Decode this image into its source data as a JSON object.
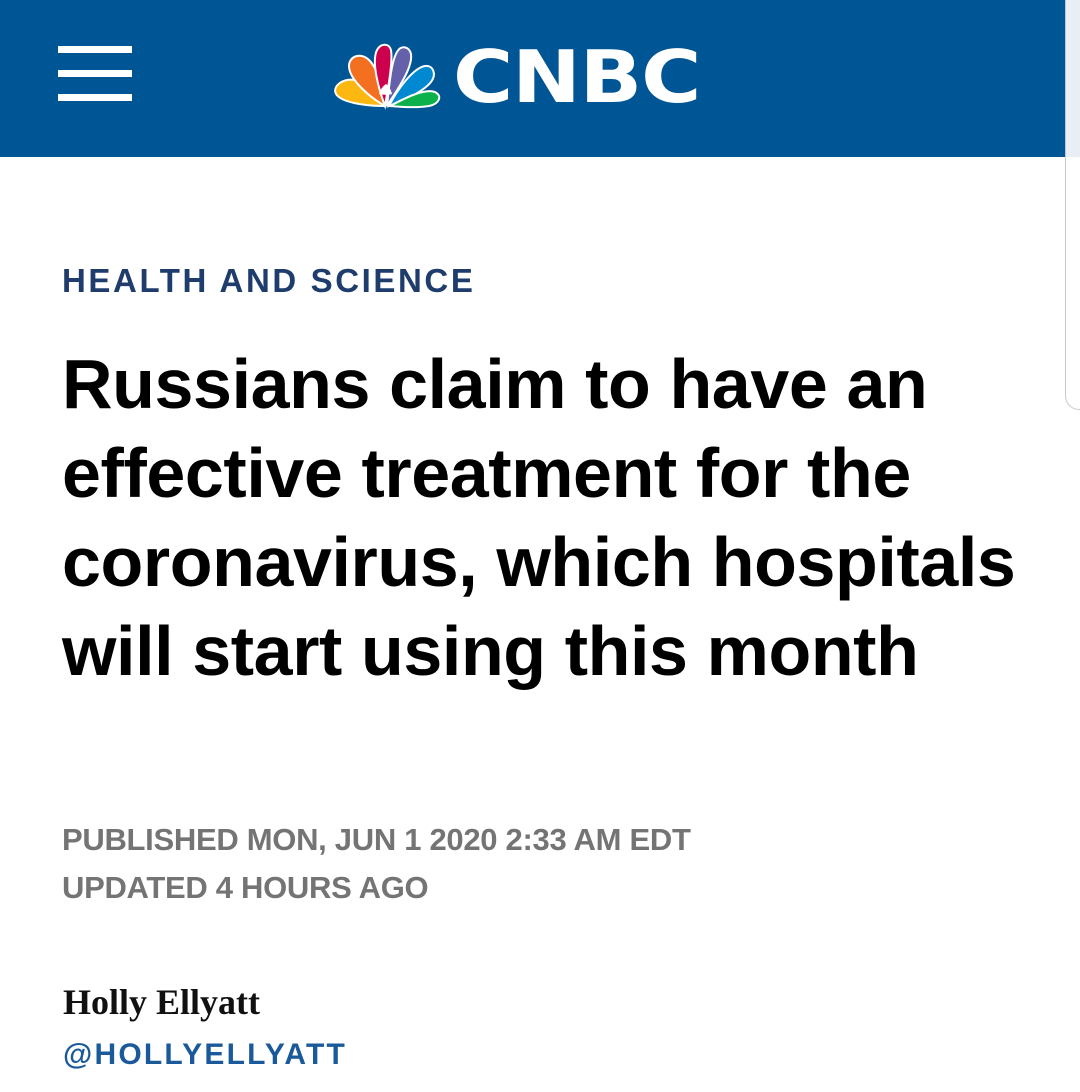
{
  "header": {
    "menu_icon": "hamburger-menu-icon",
    "logo_icon": "nbc-peacock-icon",
    "logo_text": "CNBC",
    "background_color": "#005594"
  },
  "article": {
    "section": "HEALTH AND SCIENCE",
    "headline": "Russians claim to have an effective treatment for the coronavirus, which hospitals will start using this month",
    "published": "PUBLISHED MON, JUN 1 2020 2:33 AM EDT",
    "updated": "UPDATED 4 HOURS AGO"
  },
  "author": {
    "name": "Holly Ellyatt",
    "handle": "@HOLLYELLYATT"
  },
  "colors": {
    "section": "#1e3c6c",
    "meta": "#747474",
    "handle": "#1a5a9a"
  }
}
